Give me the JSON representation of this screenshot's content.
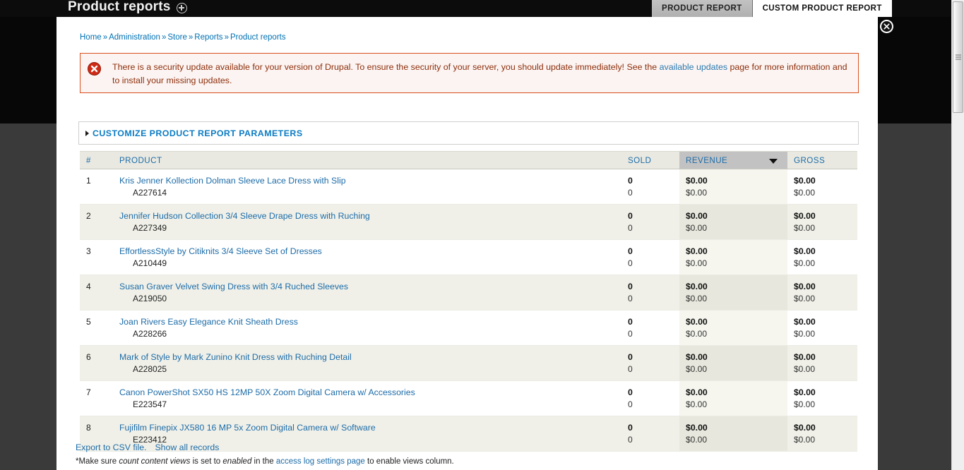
{
  "window": {
    "title": "Product reports",
    "title_icon": "circle-plus-icon",
    "close_icon": "close-icon"
  },
  "tabs": [
    {
      "label": "PRODUCT REPORT",
      "active": false
    },
    {
      "label": "CUSTOM PRODUCT REPORT",
      "active": true
    }
  ],
  "breadcrumb": {
    "separator": "»",
    "items": [
      "Home",
      "Administration",
      "Store",
      "Reports",
      "Product reports"
    ]
  },
  "message": {
    "type": "error",
    "icon": "error-circle-icon",
    "text_before": "There is a security update available for your version of Drupal. To ensure the security of your server, you should update immediately! See the ",
    "link": "available updates",
    "text_after": " page for more information and to install your missing updates.",
    "border_color": "#d8501e",
    "background_color": "#fcf4f2",
    "text_color": "#8c2e0b"
  },
  "fieldset": {
    "legend": "CUSTOMIZE PRODUCT REPORT PARAMETERS",
    "arrow_icon": "triangle-right-icon",
    "collapsed": true
  },
  "table": {
    "sorted_column": "REVENUE",
    "sort_direction": "desc",
    "sort_icon": "triangle-down-icon",
    "headers": [
      "#",
      "PRODUCT",
      "SOLD",
      "REVENUE",
      "GROSS"
    ],
    "rows": [
      {
        "index": "1",
        "product": "Kris Jenner Kollection Dolman Sleeve Lace Dress with Slip",
        "sku": "A227614",
        "sold": "0",
        "sold_sub": "0",
        "revenue": "$0.00",
        "revenue_sub": "$0.00",
        "gross": "$0.00",
        "gross_sub": "$0.00"
      },
      {
        "index": "2",
        "product": "Jennifer Hudson Collection 3/4 Sleeve Drape Dress with Ruching",
        "sku": "A227349",
        "sold": "0",
        "sold_sub": "0",
        "revenue": "$0.00",
        "revenue_sub": "$0.00",
        "gross": "$0.00",
        "gross_sub": "$0.00"
      },
      {
        "index": "3",
        "product": "EffortlessStyle by Citiknits 3/4 Sleeve Set of Dresses",
        "sku": "A210449",
        "sold": "0",
        "sold_sub": "0",
        "revenue": "$0.00",
        "revenue_sub": "$0.00",
        "gross": "$0.00",
        "gross_sub": "$0.00"
      },
      {
        "index": "4",
        "product": "Susan Graver Velvet Swing Dress with 3/4 Ruched Sleeves",
        "sku": "A219050",
        "sold": "0",
        "sold_sub": "0",
        "revenue": "$0.00",
        "revenue_sub": "$0.00",
        "gross": "$0.00",
        "gross_sub": "$0.00"
      },
      {
        "index": "5",
        "product": "Joan Rivers Easy Elegance Knit Sheath Dress",
        "sku": "A228266",
        "sold": "0",
        "sold_sub": "0",
        "revenue": "$0.00",
        "revenue_sub": "$0.00",
        "gross": "$0.00",
        "gross_sub": "$0.00"
      },
      {
        "index": "6",
        "product": "Mark of Style by Mark Zunino Knit Dress with Ruching Detail",
        "sku": "A228025",
        "sold": "0",
        "sold_sub": "0",
        "revenue": "$0.00",
        "revenue_sub": "$0.00",
        "gross": "$0.00",
        "gross_sub": "$0.00"
      },
      {
        "index": "7",
        "product": "Canon PowerShot SX50 HS 12MP 50X Zoom Digital Camera w/ Accessories",
        "sku": "E223547",
        "sold": "0",
        "sold_sub": "0",
        "revenue": "$0.00",
        "revenue_sub": "$0.00",
        "gross": "$0.00",
        "gross_sub": "$0.00"
      },
      {
        "index": "8",
        "product": "Fujifilm Finepix JX580 16 MP 5x Zoom Digital Camera w/ Software",
        "sku": "E223412",
        "sold": "0",
        "sold_sub": "0",
        "revenue": "$0.00",
        "revenue_sub": "$0.00",
        "gross": "$0.00",
        "gross_sub": "$0.00"
      }
    ]
  },
  "footer": {
    "export_link": "Export to CSV file.",
    "show_all_link": "Show all records",
    "note_part1": "*Make sure ",
    "note_em1": "count content views",
    "note_part2": " is set to ",
    "note_em2": "enabled",
    "note_part3": " in the ",
    "note_link": "access log settings page",
    "note_part4": " to enable views column."
  },
  "scrollbar": {
    "orientation": "vertical",
    "thumb_position_percent": 0
  }
}
